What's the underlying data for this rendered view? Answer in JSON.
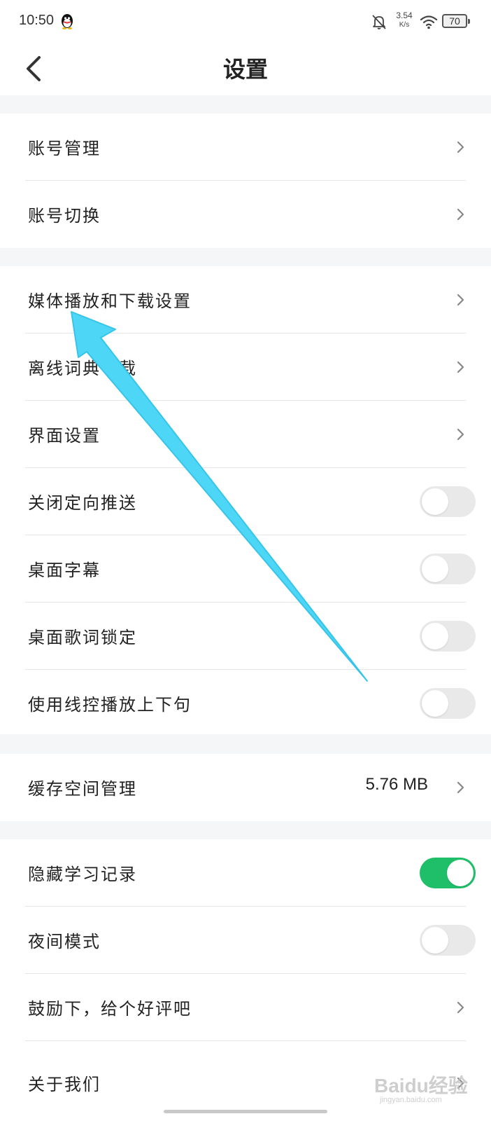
{
  "status_bar": {
    "time": "10:50",
    "net_speed_value": "3.54",
    "net_speed_unit": "K/s",
    "battery": "70",
    "icons": [
      "qq-penguin-icon",
      "bell-off-icon",
      "wifi-icon",
      "battery-icon"
    ]
  },
  "header": {
    "title": "设置",
    "back_icon": "chevron-left-icon"
  },
  "rows": {
    "account_manage": "账号管理",
    "account_switch": "账号切换",
    "media_download": "媒体播放和下载设置",
    "offline_dict": "离线词典下载",
    "interface": "界面设置",
    "disable_push": {
      "label": "关闭定向推送",
      "on": false
    },
    "desktop_subtitle": {
      "label": "桌面字幕",
      "on": false
    },
    "desktop_lyrics_lock": {
      "label": "桌面歌词锁定",
      "on": false
    },
    "wired_control": {
      "label": "使用线控播放上下句",
      "on": false
    },
    "cache": {
      "label": "缓存空间管理",
      "value": "5.76 MB"
    },
    "hide_history": {
      "label": "隐藏学习记录",
      "on": true
    },
    "night_mode": {
      "label": "夜间模式",
      "on": false
    },
    "rate_us": "鼓励下，给个好评吧",
    "about_us": "关于我们"
  },
  "colors": {
    "toggle_on": "#1fbf6a",
    "toggle_off": "#e9e9e9",
    "section_gap": "#f5f6f8",
    "annotation_arrow": "#4dd6f5"
  },
  "watermark": {
    "brand": "Baidu经验",
    "url": "jingyan.baidu.com"
  }
}
